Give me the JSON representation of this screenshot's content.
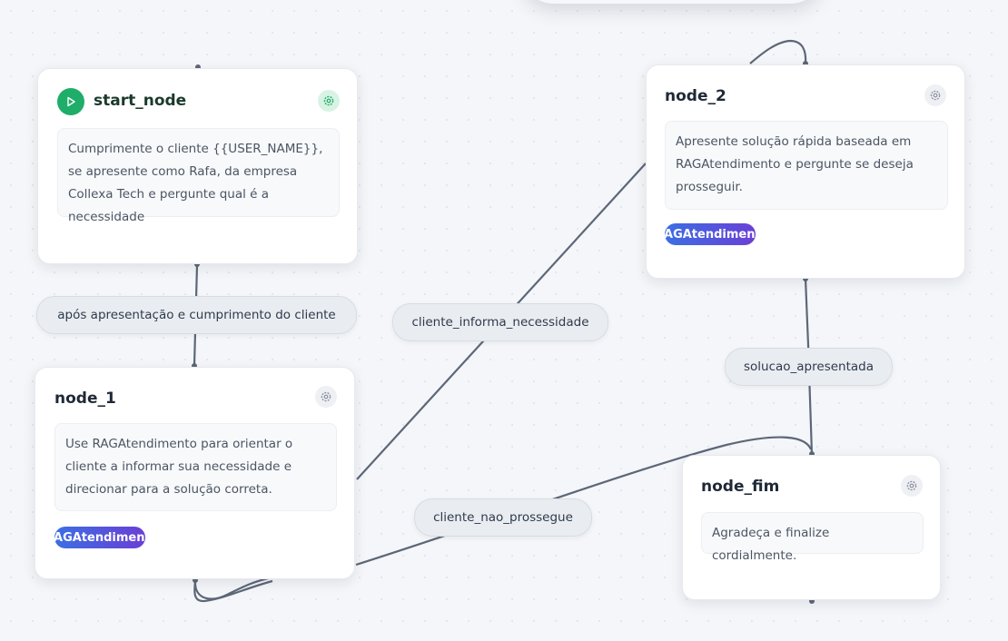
{
  "nodes": {
    "start_node": {
      "title": "start_node",
      "prompt": "Cumprimente o cliente {{USER_NAME}}, se apresente como Rafa, da empresa Collexa Tech e pergunte qual é a necessidade"
    },
    "node_1": {
      "title": "node_1",
      "prompt": "Use RAGAtendimento para orientar o cliente a informar sua necessidade e direcionar para a solução correta.",
      "tool": "RAGAtendimento"
    },
    "node_2": {
      "title": "node_2",
      "prompt": "Apresente solução rápida baseada em RAGAtendimento e pergunte se deseja prosseguir.",
      "tool": "RAGAtendimento"
    },
    "node_fim": {
      "title": "node_fim",
      "prompt": "Agradeça e finalize cordialmente."
    }
  },
  "edges": {
    "start_to_node1": "após apresentação e cumprimento do cliente",
    "node1_to_node2": "cliente_informa_necessidade",
    "node2_to_fim": "solucao_apresentada",
    "fim_to_node1": "cliente_nao_prossegue"
  },
  "icons": {
    "start": "play-icon",
    "settings": "gear-icon"
  },
  "colors": {
    "start_accent": "#1fad6a",
    "edge": "#5d6777",
    "tool_badge_start": "#3b6fe3",
    "tool_badge_end": "#6b3fd6"
  }
}
